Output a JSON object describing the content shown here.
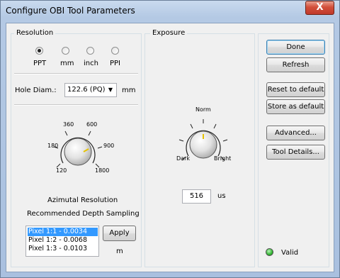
{
  "window": {
    "title": "Configure OBI Tool Parameters",
    "close_glyph": "X"
  },
  "resolution": {
    "legend": "Resolution",
    "options": [
      "PPT",
      "mm",
      "inch",
      "PPI"
    ],
    "selected": "PPT",
    "hole_diam_label": "Hole Diam.:",
    "hole_diam_value": "122.6 (PQ)",
    "hole_diam_unit": "mm",
    "knob_labels": [
      "120",
      "180",
      "360",
      "600",
      "900",
      "1800"
    ],
    "azimutal_label": "Azimutal Resolution",
    "recommended_label": "Recommended Depth Sampling",
    "sampling": [
      "Pixel 1:1 -   0.0034",
      "Pixel 1:2 -   0.0068",
      "Pixel 1:3 -   0.0103"
    ],
    "sampling_selected": 0,
    "apply_label": "Apply",
    "unit_m": "m"
  },
  "exposure": {
    "legend": "Exposure",
    "knob_labels": {
      "top": "Norm",
      "left": "Dark",
      "right": "Bright"
    },
    "value": "516",
    "unit": "us"
  },
  "buttons": {
    "done": "Done",
    "refresh": "Refresh",
    "reset": "Reset to default",
    "store": "Store as default",
    "advanced": "Advanced...",
    "tool_details": "Tool Details..."
  },
  "status": {
    "label": "Valid",
    "color": "#2fb52f"
  }
}
